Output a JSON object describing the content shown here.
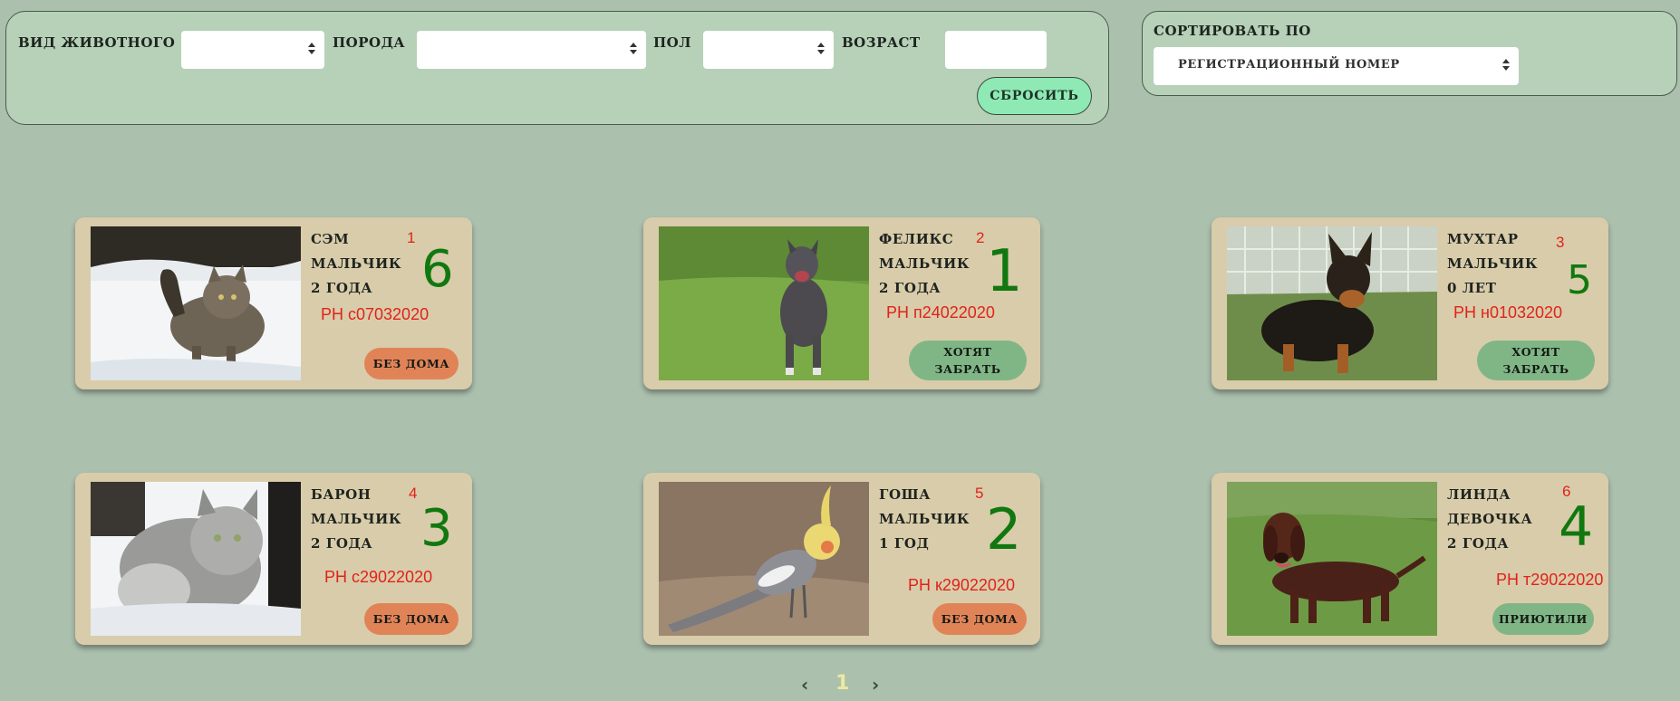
{
  "filters": {
    "animal_type_label": "вид животного",
    "animal_type_value": "",
    "breed_label": "порода",
    "breed_value": "",
    "gender_label": "пол",
    "gender_value": "",
    "age_label": "возраст",
    "age_value": "",
    "reset_label": "сбросить"
  },
  "sort": {
    "label": "сортировать по",
    "value": "регистрационный номер"
  },
  "cards": [
    {
      "index": "1",
      "name": "сэм",
      "gender": "мальчик",
      "age": "2 года",
      "reg": "РН с07032020",
      "hand": "6",
      "status": "без дома",
      "status_type": "homeless",
      "photo": "cat-photo"
    },
    {
      "index": "2",
      "name": "феликс",
      "gender": "мальчик",
      "age": "2 года",
      "reg": "РН п24022020",
      "hand": "1",
      "status_line1": "хотят",
      "status_line2": "забрать",
      "status_type": "want",
      "photo": "dog-photo"
    },
    {
      "index": "3",
      "name": "мухтар",
      "gender": "мальчик",
      "age": "0 лет",
      "reg": "РН н01032020",
      "hand": "5",
      "status_line1": "хотят",
      "status_line2": "забрать",
      "status_type": "want",
      "photo": "dog-photo"
    },
    {
      "index": "4",
      "name": "барон",
      "gender": "мальчик",
      "age": "2 года",
      "reg": "РН с29022020",
      "hand": "3",
      "status": "без дома",
      "status_type": "homeless",
      "photo": "cat-photo"
    },
    {
      "index": "5",
      "name": "гоша",
      "gender": "мальчик",
      "age": "1 год",
      "reg": "РН к29022020",
      "hand": "2",
      "status": "без дома",
      "status_type": "homeless",
      "photo": "parrot-photo"
    },
    {
      "index": "6",
      "name": "линда",
      "gender": "девочка",
      "age": "2 года",
      "reg": "РН т29022020",
      "hand": "4",
      "status": "приютили",
      "status_type": "sheltered",
      "photo": "dog-photo"
    }
  ],
  "pagination": {
    "prev": "‹",
    "current": "1",
    "next": "›"
  },
  "colors": {
    "background": "#acc0ae",
    "panel": "#b6d1b8",
    "card": "#d9ccaa",
    "homeless": "#e08458",
    "want_to_take": "#80b686",
    "reset": "#8ee9b4",
    "annotation_red": "#e0231a",
    "annotation_green": "#10780f"
  }
}
